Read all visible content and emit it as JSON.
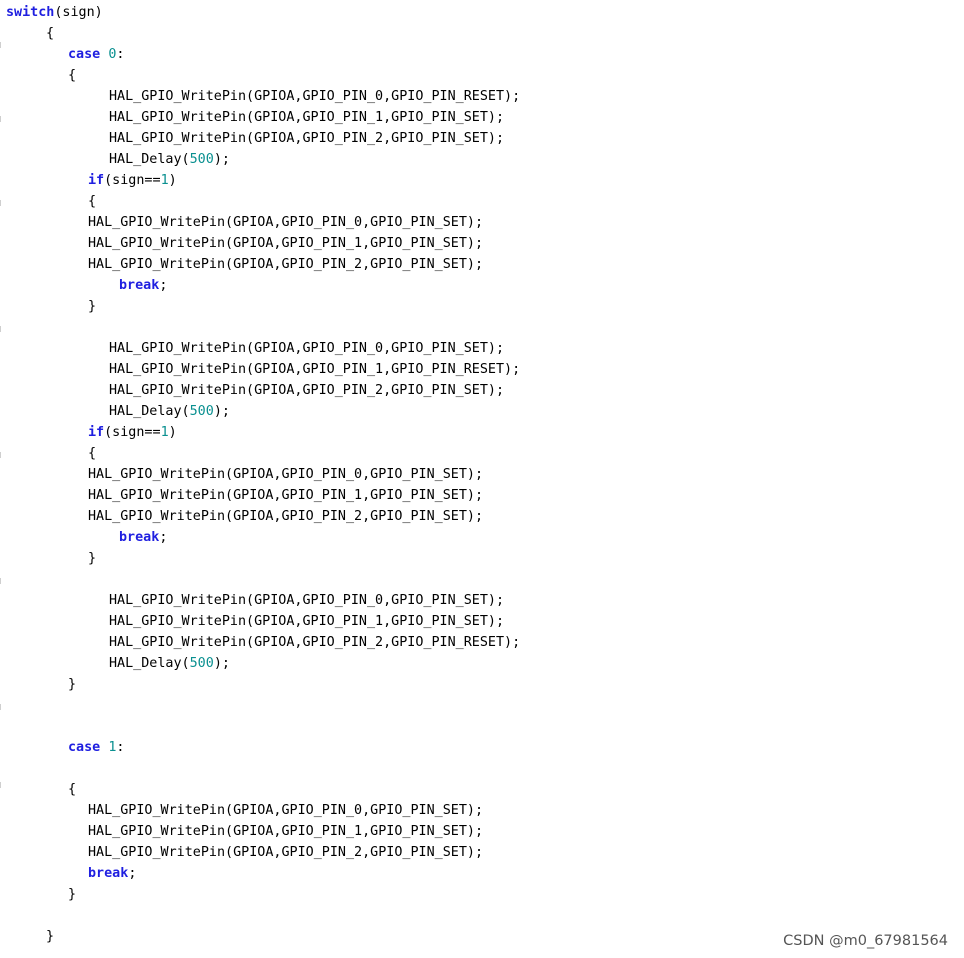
{
  "colors": {
    "keyword": "#1f1fe0",
    "number": "#0a9090",
    "text": "#000000",
    "watermark": "#555555",
    "gutter_tick": "#cfcfcf"
  },
  "code": {
    "lines": [
      [
        {
          "t": "switch",
          "k": "kw"
        },
        {
          "t": "(sign)"
        }
      ],
      [
        {
          "t": "{"
        }
      ],
      [
        {
          "t": "case",
          "k": "kw"
        },
        {
          "t": " "
        },
        {
          "t": "0",
          "k": "num"
        },
        {
          "t": ":"
        }
      ],
      [
        {
          "t": "{"
        }
      ],
      [
        {
          "t": "HAL_GPIO_WritePin(GPIOA,GPIO_PIN_0,GPIO_PIN_RESET);"
        }
      ],
      [
        {
          "t": "HAL_GPIO_WritePin(GPIOA,GPIO_PIN_1,GPIO_PIN_SET);"
        }
      ],
      [
        {
          "t": "HAL_GPIO_WritePin(GPIOA,GPIO_PIN_2,GPIO_PIN_SET);"
        }
      ],
      [
        {
          "t": "HAL_Delay("
        },
        {
          "t": "500",
          "k": "num"
        },
        {
          "t": ");"
        }
      ],
      [
        {
          "t": "if",
          "k": "kw"
        },
        {
          "t": "(sign=="
        },
        {
          "t": "1",
          "k": "num"
        },
        {
          "t": ")"
        }
      ],
      [
        {
          "t": "{"
        }
      ],
      [
        {
          "t": "HAL_GPIO_WritePin(GPIOA,GPIO_PIN_0,GPIO_PIN_SET);"
        }
      ],
      [
        {
          "t": "HAL_GPIO_WritePin(GPIOA,GPIO_PIN_1,GPIO_PIN_SET);"
        }
      ],
      [
        {
          "t": "HAL_GPIO_WritePin(GPIOA,GPIO_PIN_2,GPIO_PIN_SET);"
        }
      ],
      [
        {
          "t": "break",
          "k": "kw"
        },
        {
          "t": ";"
        }
      ],
      [
        {
          "t": "}"
        }
      ],
      [],
      [
        {
          "t": "HAL_GPIO_WritePin(GPIOA,GPIO_PIN_0,GPIO_PIN_SET);"
        }
      ],
      [
        {
          "t": "HAL_GPIO_WritePin(GPIOA,GPIO_PIN_1,GPIO_PIN_RESET);"
        }
      ],
      [
        {
          "t": "HAL_GPIO_WritePin(GPIOA,GPIO_PIN_2,GPIO_PIN_SET);"
        }
      ],
      [
        {
          "t": "HAL_Delay("
        },
        {
          "t": "500",
          "k": "num"
        },
        {
          "t": ");"
        }
      ],
      [
        {
          "t": "if",
          "k": "kw"
        },
        {
          "t": "(sign=="
        },
        {
          "t": "1",
          "k": "num"
        },
        {
          "t": ")"
        }
      ],
      [
        {
          "t": "{"
        }
      ],
      [
        {
          "t": "HAL_GPIO_WritePin(GPIOA,GPIO_PIN_0,GPIO_PIN_SET);"
        }
      ],
      [
        {
          "t": "HAL_GPIO_WritePin(GPIOA,GPIO_PIN_1,GPIO_PIN_SET);"
        }
      ],
      [
        {
          "t": "HAL_GPIO_WritePin(GPIOA,GPIO_PIN_2,GPIO_PIN_SET);"
        }
      ],
      [
        {
          "t": "break",
          "k": "kw"
        },
        {
          "t": ";"
        }
      ],
      [
        {
          "t": "}"
        }
      ],
      [],
      [
        {
          "t": "HAL_GPIO_WritePin(GPIOA,GPIO_PIN_0,GPIO_PIN_SET);"
        }
      ],
      [
        {
          "t": "HAL_GPIO_WritePin(GPIOA,GPIO_PIN_1,GPIO_PIN_SET);"
        }
      ],
      [
        {
          "t": "HAL_GPIO_WritePin(GPIOA,GPIO_PIN_2,GPIO_PIN_RESET);"
        }
      ],
      [
        {
          "t": "HAL_Delay("
        },
        {
          "t": "500",
          "k": "num"
        },
        {
          "t": ");"
        }
      ],
      [
        {
          "t": "}"
        }
      ],
      [],
      [],
      [
        {
          "t": "case",
          "k": "kw"
        },
        {
          "t": " "
        },
        {
          "t": "1",
          "k": "num"
        },
        {
          "t": ":"
        }
      ],
      [],
      [
        {
          "t": "{"
        }
      ],
      [
        {
          "t": "HAL_GPIO_WritePin(GPIOA,GPIO_PIN_0,GPIO_PIN_SET);"
        }
      ],
      [
        {
          "t": "HAL_GPIO_WritePin(GPIOA,GPIO_PIN_1,GPIO_PIN_SET);"
        }
      ],
      [
        {
          "t": "HAL_GPIO_WritePin(GPIOA,GPIO_PIN_2,GPIO_PIN_SET);"
        }
      ],
      [
        {
          "t": "break",
          "k": "kw"
        },
        {
          "t": ";"
        }
      ],
      [
        {
          "t": "}"
        }
      ],
      [],
      [
        {
          "t": "}"
        }
      ]
    ]
  },
  "watermark": {
    "text": "CSDN @m0_67981564"
  }
}
